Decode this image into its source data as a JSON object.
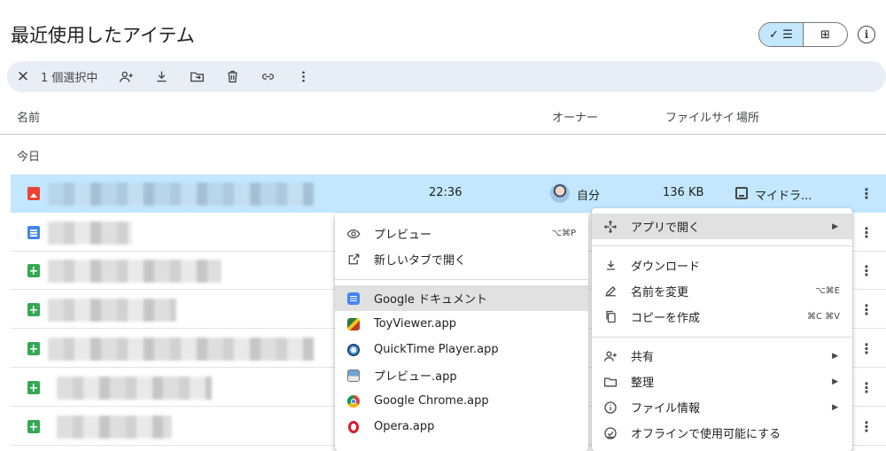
{
  "page": {
    "title": "最近使用したアイテム"
  },
  "view_toggle": {
    "list_label": "✓ ☰",
    "grid_label": "⊞"
  },
  "selection_bar": {
    "count_label": "1 個選択中"
  },
  "table_header": {
    "name": "名前",
    "owner": "オーナー",
    "size": "ファイルサイ",
    "location": "場所"
  },
  "group_label": "今日",
  "selected_row": {
    "time": "22:36",
    "owner": "自分",
    "size": "136 KB",
    "location": "マイドラ..."
  },
  "rows": [
    {
      "type": "image"
    },
    {
      "type": "doc"
    },
    {
      "type": "sheet"
    },
    {
      "type": "sheet"
    },
    {
      "type": "sheet"
    },
    {
      "type": "sheet"
    },
    {
      "type": "sheet"
    }
  ],
  "open_with_menu": {
    "items": [
      {
        "label": "プレビュー",
        "shortcut": "⌥⌘P",
        "icon": "eye-icon"
      },
      {
        "label": "新しいタブで開く",
        "shortcut": "",
        "icon": "open-in-new-icon"
      }
    ],
    "apps": [
      {
        "label": "Google ドキュメント",
        "icon": "google-docs-icon"
      },
      {
        "label": "ToyViewer.app",
        "icon": "toyviewer-icon"
      },
      {
        "label": "QuickTime Player.app",
        "icon": "quicktime-icon"
      },
      {
        "label": "プレビュー.app",
        "icon": "preview-app-icon"
      },
      {
        "label": "Google Chrome.app",
        "icon": "chrome-icon"
      },
      {
        "label": "Opera.app",
        "icon": "opera-icon"
      }
    ]
  },
  "context_menu": {
    "open_with": "アプリで開く",
    "download": "ダウンロード",
    "rename": "名前を変更",
    "rename_shortcut": "⌥⌘E",
    "copy": "コピーを作成",
    "copy_shortcut": "⌘C ⌘V",
    "share": "共有",
    "organize": "整理",
    "file_info": "ファイル情報",
    "offline": "オフラインで使用可能にする"
  },
  "colors": {
    "selected_row": "#c2e7ff",
    "selection_bar": "#e9eef6",
    "menu_highlight": "#e1e1e1"
  }
}
